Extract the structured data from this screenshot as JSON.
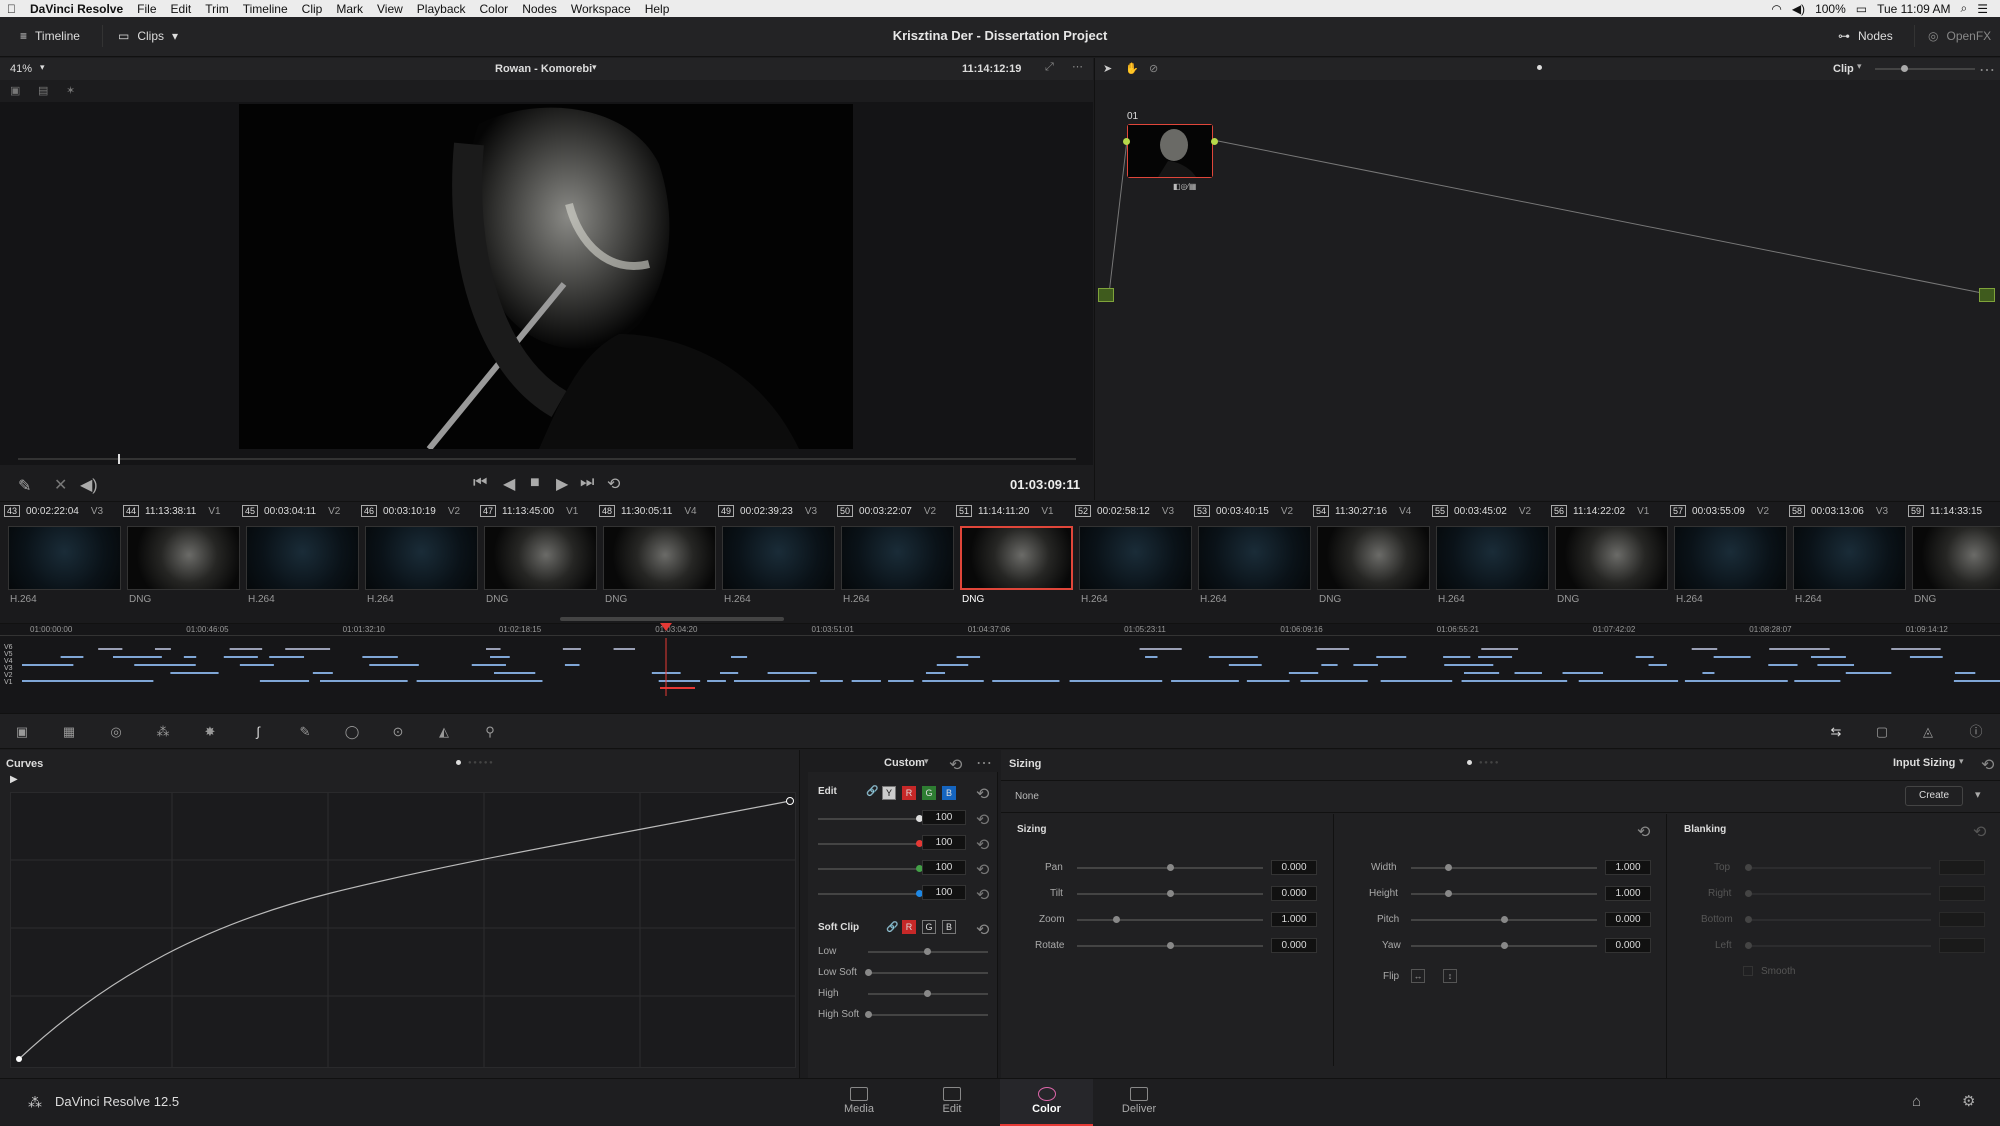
{
  "menubar": {
    "apple": "",
    "app": "DaVinci Resolve",
    "items": [
      "File",
      "Edit",
      "Trim",
      "Timeline",
      "Clip",
      "Mark",
      "View",
      "Playback",
      "Color",
      "Nodes",
      "Workspace",
      "Help"
    ],
    "battery": "100%",
    "clock": "Tue 11:09 AM"
  },
  "titlebar": {
    "timeline": "Timeline",
    "clips": "Clips",
    "project": "Krisztina Der - Dissertation Project",
    "nodes": "Nodes",
    "openfx": "OpenFX"
  },
  "viewer": {
    "zoom": "41%",
    "clip_name": "Rowan - Komorebi",
    "timecode": "11:14:12:19",
    "record_tc": "01:03:09:11"
  },
  "nodes": {
    "node_label": "01",
    "mode": "Clip"
  },
  "clips": [
    {
      "num": "43",
      "tc": "00:02:22:04",
      "track": "V3",
      "codec": "H.264"
    },
    {
      "num": "44",
      "tc": "11:13:38:11",
      "track": "V1",
      "codec": "DNG"
    },
    {
      "num": "45",
      "tc": "00:03:04:11",
      "track": "V2",
      "codec": "H.264"
    },
    {
      "num": "46",
      "tc": "00:03:10:19",
      "track": "V2",
      "codec": "H.264"
    },
    {
      "num": "47",
      "tc": "11:13:45:00",
      "track": "V1",
      "codec": "DNG"
    },
    {
      "num": "48",
      "tc": "11:30:05:11",
      "track": "V4",
      "codec": "DNG"
    },
    {
      "num": "49",
      "tc": "00:02:39:23",
      "track": "V3",
      "codec": "H.264"
    },
    {
      "num": "50",
      "tc": "00:03:22:07",
      "track": "V2",
      "codec": "H.264"
    },
    {
      "num": "51",
      "tc": "11:14:11:20",
      "track": "V1",
      "codec": "DNG"
    },
    {
      "num": "52",
      "tc": "00:02:58:12",
      "track": "V3",
      "codec": "H.264"
    },
    {
      "num": "53",
      "tc": "00:03:40:15",
      "track": "V2",
      "codec": "H.264"
    },
    {
      "num": "54",
      "tc": "11:30:27:16",
      "track": "V4",
      "codec": "DNG"
    },
    {
      "num": "55",
      "tc": "00:03:45:02",
      "track": "V2",
      "codec": "H.264"
    },
    {
      "num": "56",
      "tc": "11:14:22:02",
      "track": "V1",
      "codec": "DNG"
    },
    {
      "num": "57",
      "tc": "00:03:55:09",
      "track": "V2",
      "codec": "H.264"
    },
    {
      "num": "58",
      "tc": "00:03:13:06",
      "track": "V3",
      "codec": "H.264"
    },
    {
      "num": "59",
      "tc": "11:14:33:15",
      "track": "",
      "codec": "DNG"
    }
  ],
  "timeline": {
    "ruler": [
      "01:00:00:00",
      "01:00:46:05",
      "01:01:32:10",
      "01:02:18:15",
      "01:03:04:20",
      "01:03:51:01",
      "01:04:37:06",
      "01:05:23:11",
      "01:06:09:16",
      "01:06:55:21",
      "01:07:42:02",
      "01:08:28:07",
      "01:09:14:12"
    ],
    "tracks": [
      "V6",
      "V5",
      "V4",
      "V3",
      "V2",
      "V1"
    ]
  },
  "curves": {
    "title": "Curves",
    "preset": "Custom",
    "edit_label": "Edit",
    "channels": [
      "Y",
      "R",
      "G",
      "B"
    ],
    "channel_values": [
      "100",
      "100",
      "100",
      "100"
    ],
    "soft_clip": "Soft Clip",
    "soft_labels": [
      "Low",
      "Low Soft",
      "High",
      "High Soft"
    ]
  },
  "sizing": {
    "title": "Sizing",
    "mode": "Input Sizing",
    "preset": "None",
    "create": "Create",
    "section": "Sizing",
    "blanking": "Blanking",
    "left": [
      {
        "label": "Pan",
        "value": "0.000"
      },
      {
        "label": "Tilt",
        "value": "0.000"
      },
      {
        "label": "Zoom",
        "value": "1.000"
      },
      {
        "label": "Rotate",
        "value": "0.000"
      }
    ],
    "right": [
      {
        "label": "Width",
        "value": "1.000"
      },
      {
        "label": "Height",
        "value": "1.000"
      },
      {
        "label": "Pitch",
        "value": "0.000"
      },
      {
        "label": "Yaw",
        "value": "0.000"
      }
    ],
    "flip": "Flip",
    "blank_labels": [
      "Top",
      "Right",
      "Bottom",
      "Left"
    ],
    "smooth": "Smooth"
  },
  "bottom": {
    "app_version": "DaVinci Resolve 12.5",
    "pages": [
      "Media",
      "Edit",
      "Color",
      "Deliver"
    ]
  }
}
